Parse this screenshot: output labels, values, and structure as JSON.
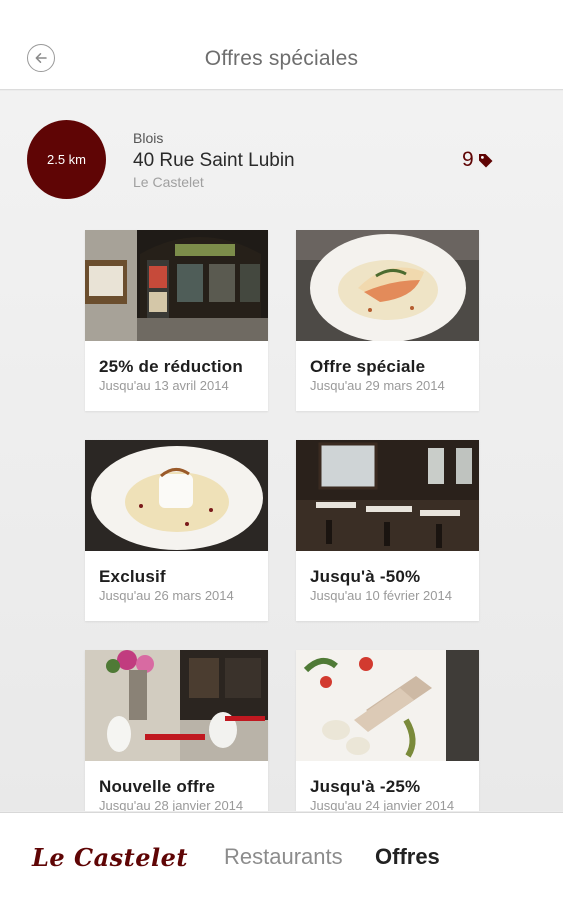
{
  "header": {
    "title": "Offres spéciales",
    "back_icon": "arrow-left-circle-icon"
  },
  "location": {
    "distance": "2.5 km",
    "city": "Blois",
    "address": "40 Rue Saint Lubin",
    "name": "Le Castelet",
    "offer_count": "9",
    "offer_icon": "tag-icon"
  },
  "offers": [
    {
      "title": "25% de réduction",
      "date": "Jusqu'au 13 avril 2014",
      "image": "storefront-photo"
    },
    {
      "title": "Offre spéciale",
      "date": "Jusqu'au 29 mars 2014",
      "image": "plated-fish-photo"
    },
    {
      "title": "Exclusif",
      "date": "Jusqu'au 26 mars 2014",
      "image": "dessert-photo"
    },
    {
      "title": "Jusqu'à -50%",
      "date": "Jusqu'au 10 février 2014",
      "image": "dining-room-photo"
    },
    {
      "title": "Nouvelle offre",
      "date": "Jusqu'au 28 janvier 2014",
      "image": "terrace-photo"
    },
    {
      "title": "Jusqu'à -25%",
      "date": "Jusqu'au 24 janvier 2014",
      "image": "terrine-photo"
    }
  ],
  "bottom_nav": {
    "brand": "Le Castelet",
    "restaurants_label": "Restaurants",
    "offres_label": "Offres"
  },
  "colors": {
    "accent": "#5f0505",
    "background": "#ececec"
  }
}
